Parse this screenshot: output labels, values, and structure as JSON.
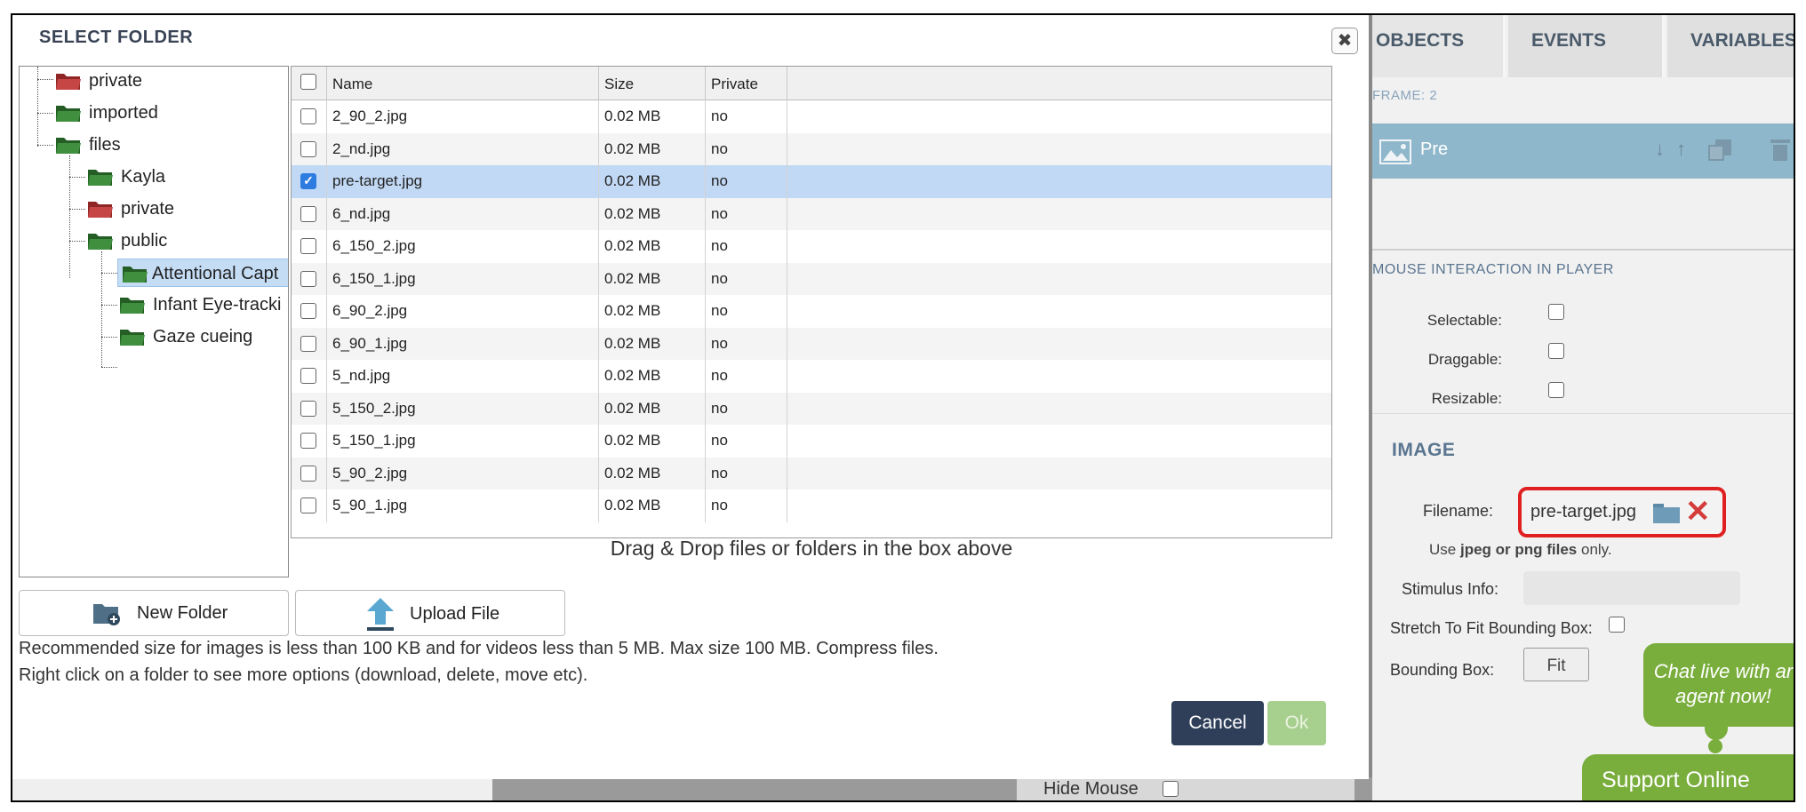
{
  "modal": {
    "title": "SELECT FOLDER",
    "close_icon": "close-icon",
    "tree": [
      {
        "label": "private",
        "color": "red"
      },
      {
        "label": "imported",
        "color": "green"
      },
      {
        "label": "files",
        "color": "green"
      },
      {
        "label": "Kayla",
        "color": "green"
      },
      {
        "label": "private",
        "color": "red"
      },
      {
        "label": "public",
        "color": "green"
      },
      {
        "label": "Attentional Capt",
        "color": "green",
        "selected": true
      },
      {
        "label": "Infant Eye-tracki",
        "color": "green"
      },
      {
        "label": "Gaze cueing",
        "color": "green"
      }
    ],
    "columns": {
      "name": "Name",
      "size": "Size",
      "private": "Private"
    },
    "files": [
      {
        "name": "2_90_2.jpg",
        "size": "0.02 MB",
        "private": "no"
      },
      {
        "name": "2_nd.jpg",
        "size": "0.02 MB",
        "private": "no"
      },
      {
        "name": "pre-target.jpg",
        "size": "0.02 MB",
        "private": "no",
        "checked": true
      },
      {
        "name": "6_nd.jpg",
        "size": "0.02 MB",
        "private": "no"
      },
      {
        "name": "6_150_2.jpg",
        "size": "0.02 MB",
        "private": "no"
      },
      {
        "name": "6_150_1.jpg",
        "size": "0.02 MB",
        "private": "no"
      },
      {
        "name": "6_90_2.jpg",
        "size": "0.02 MB",
        "private": "no"
      },
      {
        "name": "6_90_1.jpg",
        "size": "0.02 MB",
        "private": "no"
      },
      {
        "name": "5_nd.jpg",
        "size": "0.02 MB",
        "private": "no"
      },
      {
        "name": "5_150_2.jpg",
        "size": "0.02 MB",
        "private": "no"
      },
      {
        "name": "5_150_1.jpg",
        "size": "0.02 MB",
        "private": "no"
      },
      {
        "name": "5_90_2.jpg",
        "size": "0.02 MB",
        "private": "no"
      },
      {
        "name": "5_90_1.jpg",
        "size": "0.02 MB",
        "private": "no"
      }
    ],
    "dnd_hint": "Drag & Drop files or folders in the box above",
    "new_folder": "New Folder",
    "upload_file": "Upload File",
    "recommend_line1": "Recommended size for images is less than 100 KB and for videos less than 5 MB. Max size 100 MB. Compress files.",
    "recommend_line2": "Right click on a folder to see more options (download, delete, move etc).",
    "cancel": "Cancel",
    "ok": "Ok"
  },
  "right": {
    "tabs": [
      "OBJECTS",
      "EVENTS",
      "VARIABLES"
    ],
    "frame_label": "FRAME: 2",
    "object_name": "Pre",
    "mouse_section": "MOUSE INTERACTION IN PLAYER",
    "selectable": "Selectable:",
    "draggable": "Draggable:",
    "resizable": "Resizable:",
    "image_section": "IMAGE",
    "filename_label": "Filename:",
    "filename_value": "pre-target.jpg",
    "use_prefix": "Use",
    "use_bold": "jpeg or png files",
    "use_suffix": "only.",
    "stimulus_label": "Stimulus Info:",
    "stretch_label": "Stretch To Fit Bounding Box:",
    "bbox_label": "Bounding Box:",
    "fit_button": "Fit",
    "hide_mouse": "Hide Mouse",
    "chat_line1": "Chat live with ar",
    "chat_line2": "agent now!",
    "support": "Support Online"
  },
  "colors": {
    "accent": "#2f7ce0",
    "highlight": "#e02020",
    "chat": "#79ad3c",
    "cancel": "#2f3f5a"
  }
}
